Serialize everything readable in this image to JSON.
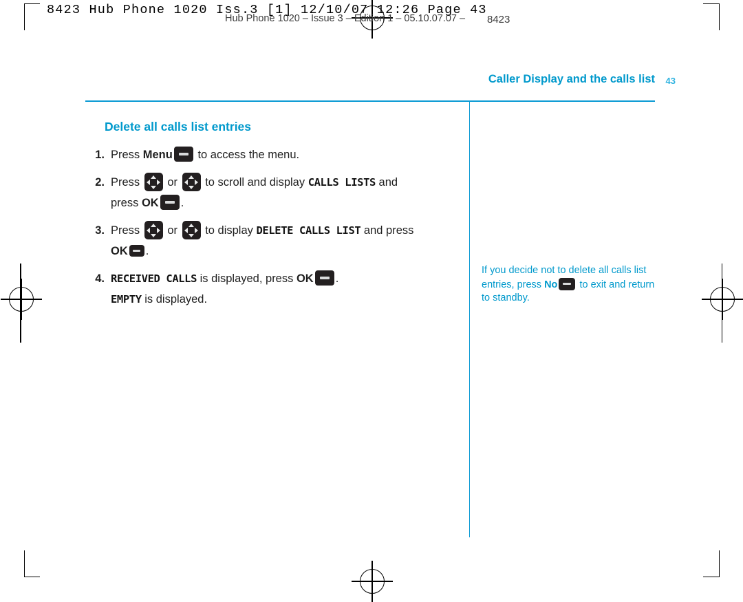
{
  "print_strip": {
    "job_line": "8423 Hub Phone 1020 Iss.3 [1]  12/10/07  12:26  Page 43",
    "doc_line": "Hub Phone 1020 – Issue 3 – Edition 1 – 05.10.07.07 –",
    "folio": "8423"
  },
  "header": {
    "running_head": "Caller Display and the calls list",
    "page_number": "43"
  },
  "section": {
    "title": "Delete all calls list entries"
  },
  "steps": [
    {
      "number": "1.",
      "parts": [
        {
          "type": "text",
          "value": "Press "
        },
        {
          "type": "bold",
          "value": "Menu"
        },
        {
          "type": "icon",
          "value": "softkey-button"
        },
        {
          "type": "text",
          "value": " to access the menu."
        }
      ]
    },
    {
      "number": "2.",
      "parts": [
        {
          "type": "text",
          "value": "Press "
        },
        {
          "type": "icon",
          "value": "navigation-key"
        },
        {
          "type": "text",
          "value": " or "
        },
        {
          "type": "icon",
          "value": "navigation-key"
        },
        {
          "type": "text",
          "value": " to scroll and display "
        },
        {
          "type": "lcd",
          "value": "CALLS LISTS"
        },
        {
          "type": "text",
          "value": " and press "
        },
        {
          "type": "bold",
          "value": "OK"
        },
        {
          "type": "icon",
          "value": "softkey-button"
        },
        {
          "type": "text",
          "value": "."
        }
      ]
    },
    {
      "number": "3.",
      "parts": [
        {
          "type": "text",
          "value": "Press "
        },
        {
          "type": "icon",
          "value": "navigation-key"
        },
        {
          "type": "text",
          "value": " or "
        },
        {
          "type": "icon",
          "value": "navigation-key"
        },
        {
          "type": "text",
          "value": " to display "
        },
        {
          "type": "lcd",
          "value": "DELETE CALLS LIST"
        },
        {
          "type": "text",
          "value": " and press "
        },
        {
          "type": "bold",
          "value": "OK"
        },
        {
          "type": "icon",
          "value": "softkey-button"
        },
        {
          "type": "text",
          "value": "."
        }
      ]
    },
    {
      "number": "4.",
      "parts": [
        {
          "type": "lcd",
          "value": "RECEIVED CALLS"
        },
        {
          "type": "text",
          "value": " is displayed, press "
        },
        {
          "type": "bold",
          "value": "OK"
        },
        {
          "type": "icon",
          "value": "softkey-button"
        },
        {
          "type": "text",
          "value": ". "
        },
        {
          "type": "lcd",
          "value": "EMPTY"
        },
        {
          "type": "text",
          "value": " is displayed."
        }
      ]
    }
  ],
  "step_text": {
    "s1_a": "Press ",
    "s1_menu": "Menu",
    "s1_b": " to access the menu.",
    "s2_a": "Press ",
    "s2_or": " or ",
    "s2_b": " to scroll and display ",
    "s2_lcd": "CALLS LISTS",
    "s2_c": " and",
    "s2_d": "press ",
    "s2_ok": "OK",
    "s2_end": ".",
    "s3_a": "Press ",
    "s3_or": " or ",
    "s3_b": " to display ",
    "s3_lcd": "DELETE CALLS LIST",
    "s3_c": " and press",
    "s3_ok": "OK",
    "s3_end": ".",
    "s4_lcd1": "RECEIVED CALLS",
    "s4_a": " is displayed, press ",
    "s4_ok": "OK",
    "s4_b": ".",
    "s4_lcd2": "EMPTY",
    "s4_c": " is displayed.",
    "numbers": [
      "1.",
      "2.",
      "3.",
      "4."
    ]
  },
  "note": {
    "a": "If you decide not to delete all calls list entries, press ",
    "no_label": "No",
    "b": " to exit and return to standby."
  },
  "colors": {
    "accent": "#0099cc",
    "rule": "#0b9ad4",
    "key_body": "#231f20",
    "key_glyph": "#e9eaea",
    "text": "#1f1f1f"
  }
}
